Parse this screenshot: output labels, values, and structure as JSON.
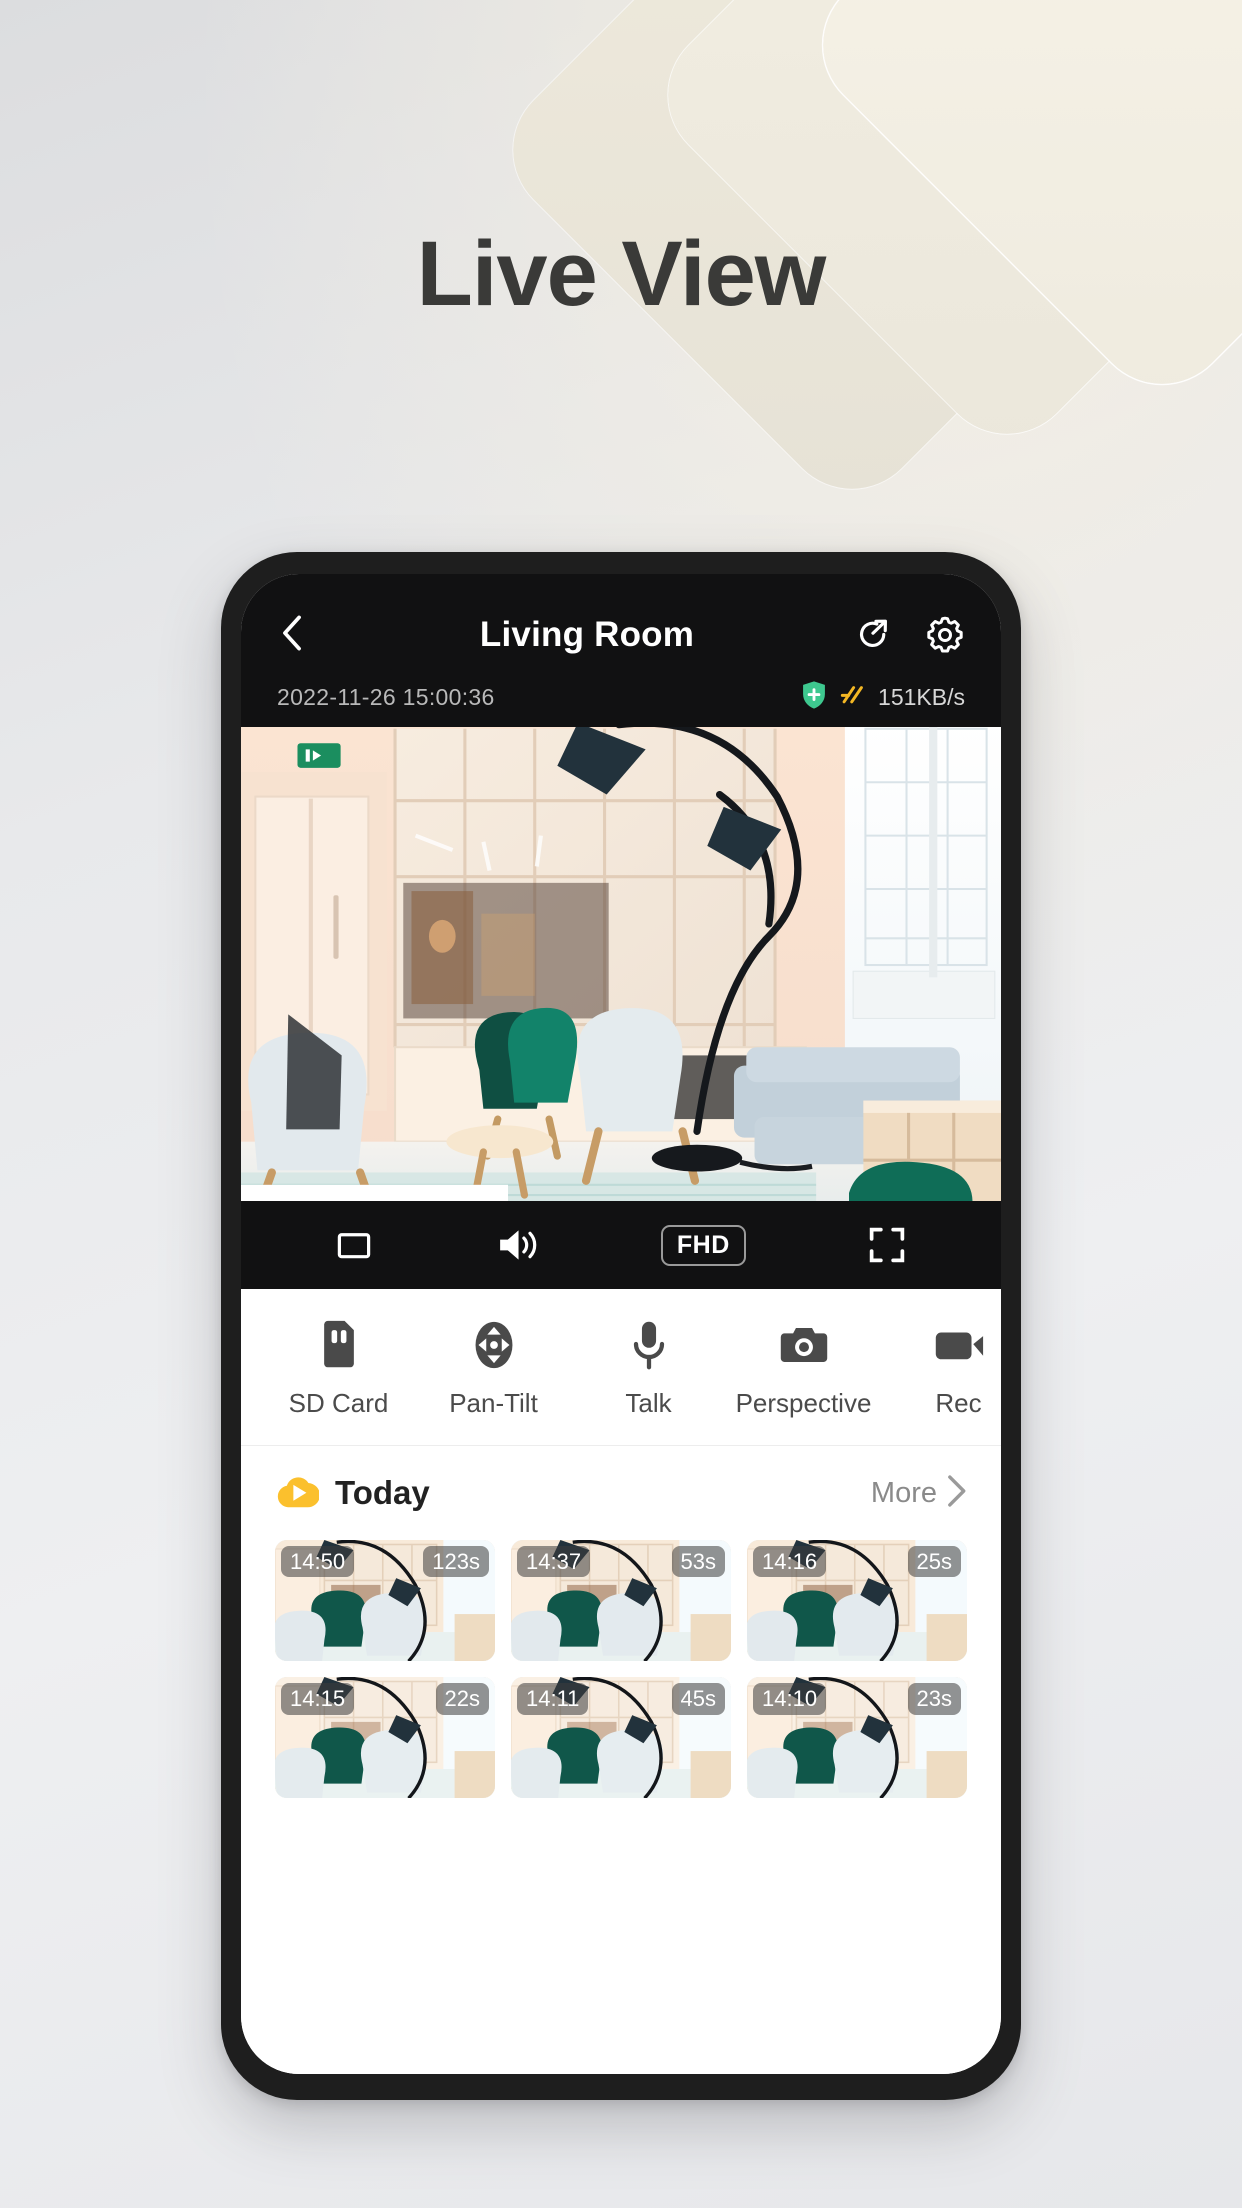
{
  "page": {
    "headline": "Live View",
    "background_accent": "#f3efe3",
    "background_base": "#e9eaec"
  },
  "app": {
    "header": {
      "back_icon": "chevron-left-icon",
      "title": "Living Room",
      "share_icon": "share-arrow-icon",
      "settings_icon": "gear-icon"
    },
    "status": {
      "timestamp": "2022-11-26 15:00:36",
      "shield_icon": "shield-plus-icon",
      "shield_color": "#4ecb9b",
      "speed_icon": "network-speed-icon",
      "speed_color": "#f5b82e",
      "network_speed": "151KB/s"
    },
    "video_controls": [
      {
        "name": "aspect-ratio-button",
        "icon": "rectangle-icon",
        "label": ""
      },
      {
        "name": "sound-button",
        "icon": "speaker-on-icon",
        "label": ""
      },
      {
        "name": "quality-button",
        "icon": "quality-badge",
        "label": "FHD"
      },
      {
        "name": "fullscreen-button",
        "icon": "fullscreen-expand-icon",
        "label": ""
      }
    ],
    "functions": [
      {
        "label": "SD Card",
        "icon": "sd-card-icon"
      },
      {
        "label": "Pan-Tilt",
        "icon": "pan-tilt-icon"
      },
      {
        "label": "Talk",
        "icon": "microphone-icon"
      },
      {
        "label": "Perspective",
        "icon": "camera-icon"
      },
      {
        "label": "Rec",
        "icon": "record-icon"
      }
    ],
    "today": {
      "cloud_icon": "cloud-play-icon",
      "cloud_icon_color": "#fbc02d",
      "title": "Today",
      "more_label": "More",
      "more_icon": "chevron-right-icon",
      "clips": [
        {
          "time": "14:50",
          "duration": "123s"
        },
        {
          "time": "14:37",
          "duration": "53s"
        },
        {
          "time": "14:16",
          "duration": "25s"
        },
        {
          "time": "14:15",
          "duration": "22s"
        },
        {
          "time": "14:11",
          "duration": "45s"
        },
        {
          "time": "14:10",
          "duration": "23s"
        }
      ]
    }
  }
}
